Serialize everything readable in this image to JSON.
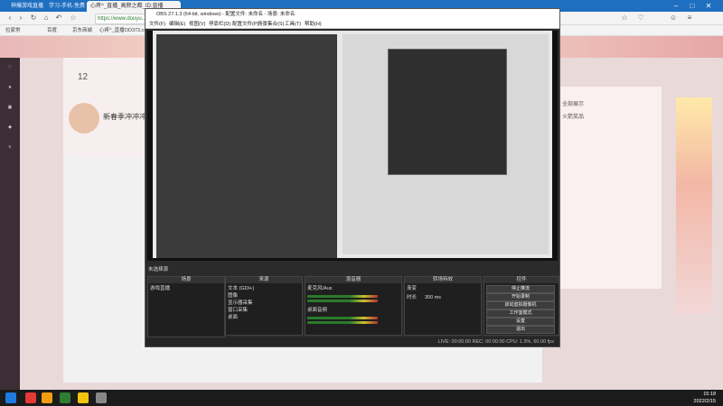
{
  "browser": {
    "tabs": [
      {
        "label": "神爆游戏直播",
        "active": false
      },
      {
        "label": "学习-手机-免费",
        "active": false
      },
      {
        "label": "心疼",
        "active": false
      },
      {
        "label": "心疼^_直播_高颜之都_ID:直播",
        "active": true
      }
    ],
    "url": "https://www.douyu...",
    "bookmarks": [
      "拉家常",
      "百度",
      "京东商城",
      "心疼^_直播",
      "DD373.com"
    ]
  },
  "douyu": {
    "stats_num": "12",
    "room_title": "新春季冲冲冲",
    "right_panel_link_1": "全部展示",
    "right_panel_link_2": "火箭奖品"
  },
  "obs": {
    "title": "OBS 27.1.3 (64-bit, windows) - 配置文件: 未命名 - 场景: 未命名",
    "menu": [
      "文件(F)",
      "编辑(E)",
      "视图(V)",
      "停靠栏(D)",
      "配置文件(P)",
      "场景集合(S)",
      "工具(T)",
      "帮助(H)"
    ],
    "status": "未选择源",
    "docks": {
      "scenes": {
        "title": "场景",
        "items": [
          "游戏直播"
        ]
      },
      "sources": {
        "title": "来源",
        "items": [
          "文本 (GDI+)",
          "图像",
          "显示器采集",
          "窗口采集",
          "桌面"
        ]
      },
      "mixer": {
        "title": "混音器",
        "items": [
          "麦克风/Aux",
          "桌面音频"
        ]
      },
      "transitions": {
        "title": "转场特效",
        "type": "渐变",
        "duration_label": "时长",
        "duration": "300 ms"
      },
      "controls": {
        "title": "控件",
        "buttons": [
          "停止推流",
          "开始录制",
          "启动虚拟摄像机",
          "工作室模式",
          "设置",
          "退出"
        ]
      }
    },
    "footer": "LIVE: 00:00:00  REC: 00:00:00  CPU: 1.3%, 60.00 fps"
  },
  "taskbar": {
    "time": "15:18",
    "date": "2022/2/15"
  }
}
